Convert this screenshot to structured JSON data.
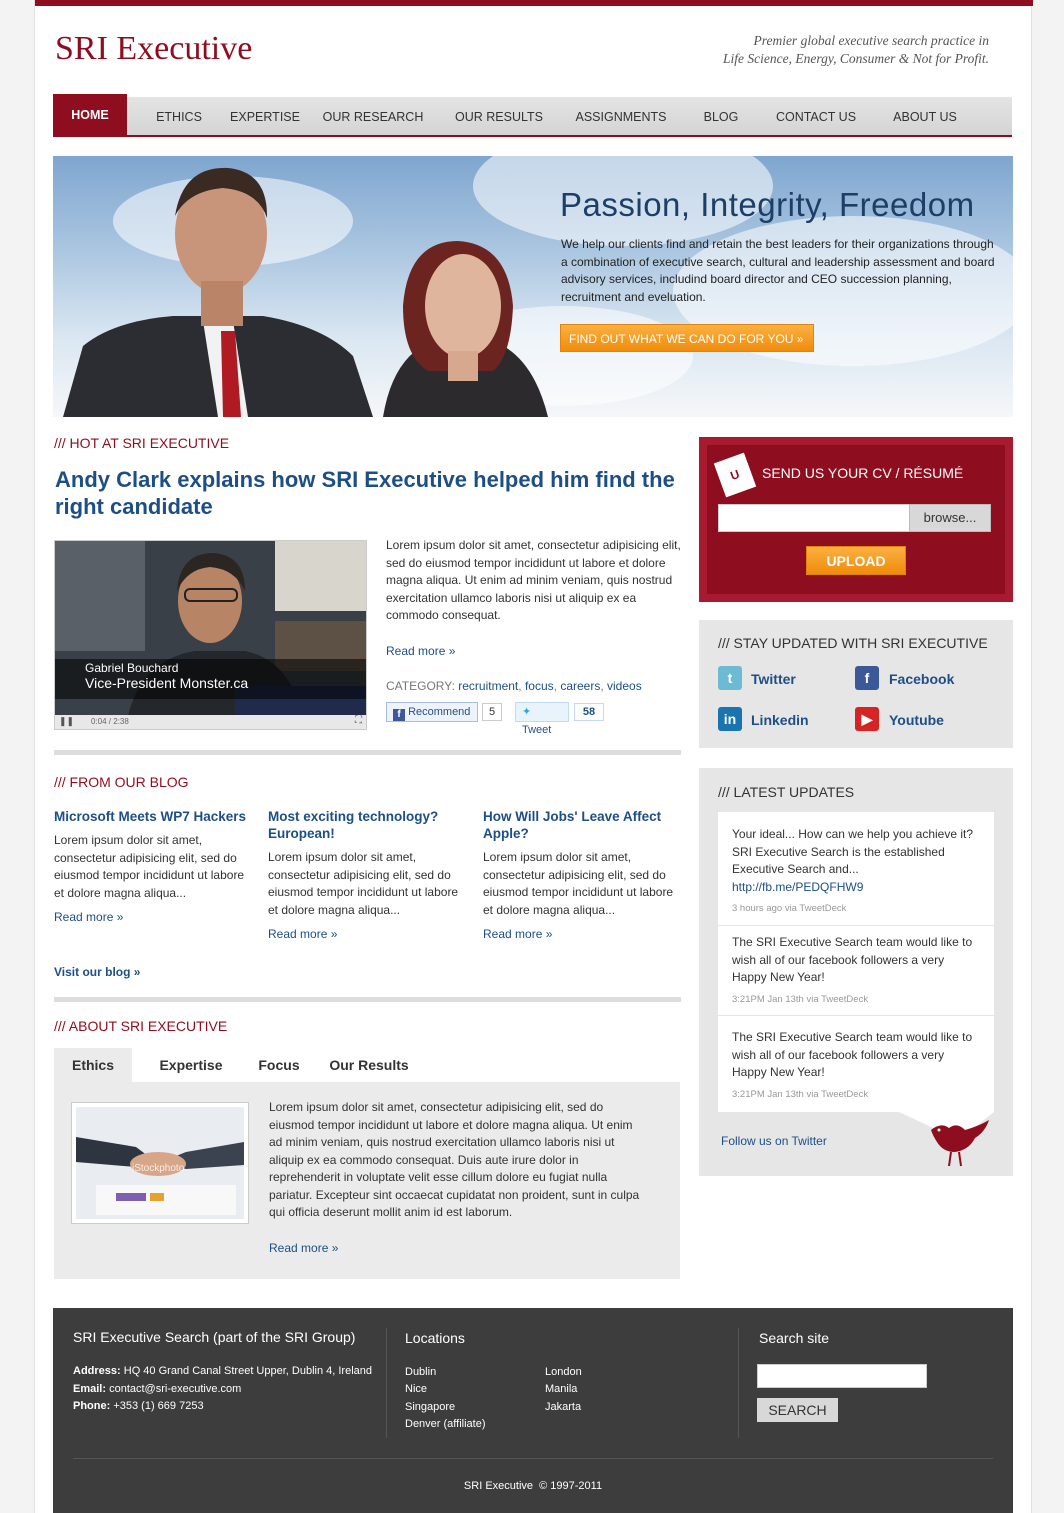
{
  "header": {
    "logo": "SRI Executive",
    "tagline_line1": "Premier global executive search practice in",
    "tagline_line2": "Life Science, Energy, Consumer & Not for Profit."
  },
  "nav": {
    "items": [
      {
        "label": "HOME"
      },
      {
        "label": "ETHICS"
      },
      {
        "label": "EXPERTISE"
      },
      {
        "label": "OUR RESEARCH"
      },
      {
        "label": "OUR RESULTS"
      },
      {
        "label": "ASSIGNMENTS"
      },
      {
        "label": "BLOG"
      },
      {
        "label": "CONTACT US"
      },
      {
        "label": "ABOUT US"
      }
    ]
  },
  "hero": {
    "title": "Passion, Integrity, Freedom",
    "text": "We help our clients find and retain the best leaders for their organizations through a combination of executive search, cultural and leadership assessment and board advisory services, includind board director and CEO succession planning, recruitment and eveluation.",
    "cta": "FIND OUT WHAT WE CAN DO FOR YOU »"
  },
  "hot": {
    "heading": "/// HOT AT SRI EXECUTIVE",
    "title": "Andy Clark explains how SRI Executive helped him find the right candidate",
    "video_name": "Gabriel Bouchard",
    "video_role": "Vice-President Monster.ca",
    "video_time": "0:04 / 2:38",
    "text": "Lorem ipsum dolor sit amet, consectetur adipisicing elit, sed do eiusmod tempor incididunt ut labore et dolore magna aliqua. Ut enim ad minim veniam, quis nostrud exercitation ullamco laboris nisi ut aliquip ex ea commodo consequat.",
    "read_more": "Read more »",
    "category_label": "CATEGORY:",
    "categories": [
      "recruitment",
      "focus",
      "careers",
      "videos"
    ],
    "recommend_label": "Recommend",
    "recommend_count": "5",
    "tweet_label": "Tweet",
    "tweet_count": "58"
  },
  "blog": {
    "heading": "/// FROM OUR BLOG",
    "posts": [
      {
        "title": "Microsoft Meets WP7 Hackers",
        "text": "Lorem ipsum dolor sit amet, consectetur adipisicing elit, sed do eiusmod tempor incididunt ut labore et dolore magna aliqua...",
        "read_more": "Read more »"
      },
      {
        "title": "Most exciting technology? European!",
        "text": "Lorem ipsum dolor sit amet, consectetur adipisicing elit, sed do eiusmod tempor incididunt ut labore et dolore magna aliqua...",
        "read_more": "Read more »"
      },
      {
        "title": "How Will Jobs' Leave Affect Apple?",
        "text": "Lorem ipsum dolor sit amet, consectetur adipisicing elit, sed do eiusmod tempor incididunt ut labore et dolore magna aliqua...",
        "read_more": "Read more »"
      }
    ],
    "visit": "Visit our blog »"
  },
  "about": {
    "heading": "/// ABOUT SRI EXECUTIVE",
    "tabs": [
      "Ethics",
      "Expertise",
      "Focus",
      "Our Results"
    ],
    "image_watermark": "iStockphoto",
    "text": "Lorem ipsum dolor sit amet, consectetur adipisicing elit, sed do eiusmod tempor incididunt ut labore et dolore magna aliqua. Ut enim ad minim veniam, quis nostrud exercitation ullamco laboris nisi ut aliquip ex ea commodo consequat. Duis aute irure dolor in reprehenderit in voluptate velit esse cillum dolore eu fugiat nulla pariatur. Excepteur sint occaecat cupidatat non proident, sunt in culpa qui officia deserunt mollit anim id est laborum.",
    "read_more": "Read more »"
  },
  "cv": {
    "title": "SEND US YOUR CV / RÉSUMÉ",
    "browse": "browse...",
    "upload": "UPLOAD"
  },
  "stay": {
    "heading": "/// STAY UPDATED WITH SRI EXECUTIVE",
    "twitter": "Twitter",
    "facebook": "Facebook",
    "linkedin": "Linkedin",
    "youtube": "Youtube"
  },
  "updates": {
    "heading": "/// LATEST UPDATES",
    "tweets": [
      {
        "text": "Your ideal... How can we help you achieve it? SRI Executive Search is the established Executive Search and...",
        "link": "http://fb.me/PEDQFHW9",
        "meta": "3 hours ago via TweetDeck"
      },
      {
        "text": "The SRI Executive Search team would like to wish all of our facebook followers a very Happy New Year!",
        "meta": "3:21PM Jan 13th via TweetDeck"
      },
      {
        "text": "The SRI Executive Search team would like to wish all of our facebook followers a very Happy New Year!",
        "meta": "3:21PM Jan 13th via TweetDeck"
      }
    ],
    "follow": "Follow us on Twitter"
  },
  "footer": {
    "company": "SRI Executive Search (part of the SRI Group)",
    "address_label": "Address:",
    "address": "HQ 40 Grand Canal Street Upper, Dublin 4, Ireland",
    "email_label": "Email:",
    "email": "contact@sri-executive.com",
    "phone_label": "Phone:",
    "phone": "+353 (1) 669 7253",
    "locations_heading": "Locations",
    "locations_col1": [
      "Dublin",
      "Nice",
      "Singapore",
      "Denver (affiliate)"
    ],
    "locations_col2": [
      "London",
      "Manila",
      "Jakarta"
    ],
    "search_heading": "Search site",
    "search_button": "SEARCH",
    "copyright": "SRI Executive  © 1997-2011"
  },
  "colors": {
    "brand": "#8e0e1f",
    "link": "#1d4f86",
    "cta": "#f08c0a",
    "footer": "#3d3d3d"
  }
}
